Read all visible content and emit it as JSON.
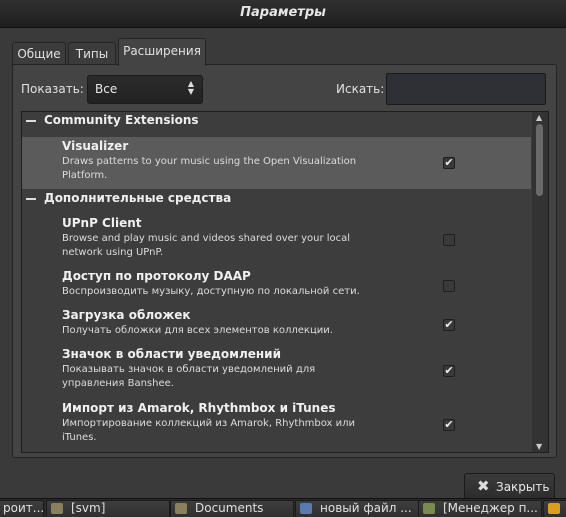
{
  "window": {
    "title": "Параметры"
  },
  "tabs": [
    "Общие",
    "Типы",
    "Расширения"
  ],
  "toolbar": {
    "show_label": "Показать:",
    "show_value": "Все",
    "search_label": "Искать:",
    "search_value": ""
  },
  "groups": [
    {
      "title": "Community Extensions",
      "items": [
        {
          "title": "Visualizer",
          "desc": "Draws patterns to your music using the Open Visualization Platform.",
          "checked": true,
          "selected": true
        }
      ]
    },
    {
      "title": "Дополнительные средства",
      "items": [
        {
          "title": "UPnP Client",
          "desc": "Browse and play music and videos shared over your local network using UPnP.",
          "checked": false
        },
        {
          "title": "Доступ по протоколу DAAP",
          "desc": "Воспроизводить музыку, доступную по локальной сети.",
          "checked": false
        },
        {
          "title": "Загрузка обложек",
          "desc": "Получать обложки для всех элементов коллекции.",
          "checked": true
        },
        {
          "title": "Значок в области уведомлений",
          "desc": "Показывать значок в области уведомлений для управления Banshee.",
          "checked": true
        },
        {
          "title": "Импорт из Amarok, Rhythmbox и iTunes",
          "desc": "Импортирование коллекций из Amarok, Rhythmbox или iTunes.",
          "checked": true
        }
      ]
    }
  ],
  "close_button": {
    "label": "Закрыть"
  },
  "taskbar": [
    {
      "label": "роит...",
      "icon": "app-icon"
    },
    {
      "label": "[svm]",
      "icon": "folder-icon"
    },
    {
      "label": "Documents",
      "icon": "folder-icon"
    },
    {
      "label": "новый файл ...",
      "icon": "editor-icon"
    },
    {
      "label": "[Менеджер п...",
      "icon": "package-icon"
    },
    {
      "label": "",
      "icon": "banshee-icon"
    }
  ],
  "colors": {
    "accent_check": "#eeeeee",
    "selection": "#5b5b5b"
  }
}
